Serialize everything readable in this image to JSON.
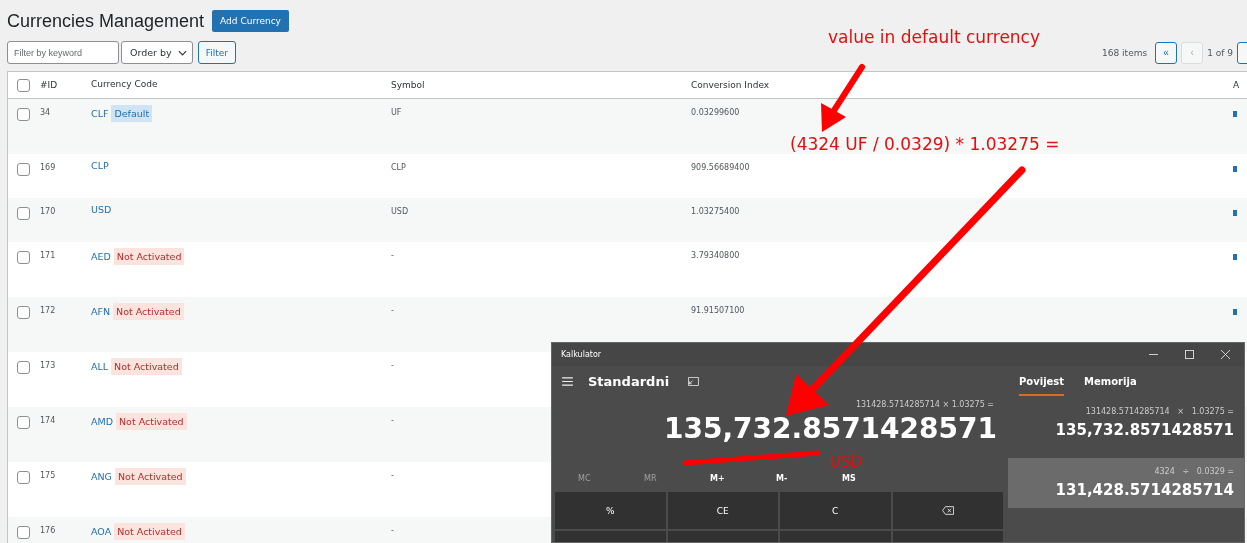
{
  "page": {
    "title": "Currencies Management",
    "add_button": "Add Currency"
  },
  "filters": {
    "keyword_placeholder": "Filter by keyword",
    "order_by": "Order by",
    "filter_button": "Filter"
  },
  "pagination": {
    "count": "168 items",
    "first": "«",
    "prev": "‹",
    "page": "1 of 9"
  },
  "table": {
    "select_all": {
      "checked": false
    },
    "columns": [
      "#ID",
      "Currency Code",
      "Symbol",
      "Conversion Index",
      "A"
    ],
    "rows": [
      {
        "checked": false,
        "id": "34",
        "code": "CLF",
        "badge": {
          "kind": "default",
          "text": "Default"
        },
        "symbol": "UF",
        "conversion": "0.03299600"
      },
      {
        "checked": false,
        "id": "169",
        "code": "CLP",
        "symbol": "CLP",
        "conversion": "909.56689400"
      },
      {
        "checked": false,
        "id": "170",
        "code": "USD",
        "symbol": "USD",
        "conversion": "1.03275400"
      },
      {
        "checked": false,
        "id": "171",
        "code": "AED",
        "badge": {
          "kind": "inactive",
          "text": "Not Activated"
        },
        "symbol": "-",
        "conversion": "3.79340800"
      },
      {
        "checked": false,
        "id": "172",
        "code": "AFN",
        "badge": {
          "kind": "inactive",
          "text": "Not Activated"
        },
        "symbol": "-",
        "conversion": "91.91507100"
      },
      {
        "checked": false,
        "id": "173",
        "code": "ALL",
        "badge": {
          "kind": "inactive",
          "text": "Not Activated"
        },
        "symbol": "-"
      },
      {
        "checked": false,
        "id": "174",
        "code": "AMD",
        "badge": {
          "kind": "inactive",
          "text": "Not Activated"
        },
        "symbol": "-"
      },
      {
        "checked": false,
        "id": "175",
        "code": "ANG",
        "badge": {
          "kind": "inactive",
          "text": "Not Activated"
        },
        "symbol": "-"
      },
      {
        "checked": false,
        "id": "176",
        "code": "AOA",
        "badge": {
          "kind": "inactive",
          "text": "Not Activated"
        },
        "symbol": "-"
      }
    ]
  },
  "calculator": {
    "title": "Kalkulator",
    "mode": "Standardni",
    "expression": "131428.5714285714 × 1.03275 =",
    "display": "135,732.8571428571",
    "memory": [
      {
        "label": "MC",
        "disabled": true
      },
      {
        "label": "MR",
        "disabled": true
      },
      {
        "label": "M+",
        "disabled": false
      },
      {
        "label": "M-",
        "disabled": false
      },
      {
        "label": "MS",
        "disabled": false
      }
    ],
    "keys": [
      {
        "kind": "text",
        "label": "%"
      },
      {
        "kind": "text",
        "label": "CE"
      },
      {
        "kind": "text",
        "label": "C"
      },
      {
        "kind": "backspace"
      }
    ],
    "tabs": [
      {
        "label": "Povijest",
        "selected": true
      },
      {
        "label": "Memorija",
        "selected": false
      }
    ],
    "history": [
      {
        "expression": "131428.5714285714   ×   1.03275 =",
        "result": "135,732.8571428571",
        "selected": false
      },
      {
        "expression": "4324   ÷   0.0329 =",
        "result": "131,428.5714285714",
        "selected": true
      }
    ]
  },
  "annotations": [
    {
      "kind": "heading",
      "text": "value in default currency"
    },
    {
      "kind": "formula",
      "text": "(4324 UF / 0.0329) * 1.03275 ="
    },
    {
      "kind": "unit",
      "text": "USD"
    }
  ]
}
